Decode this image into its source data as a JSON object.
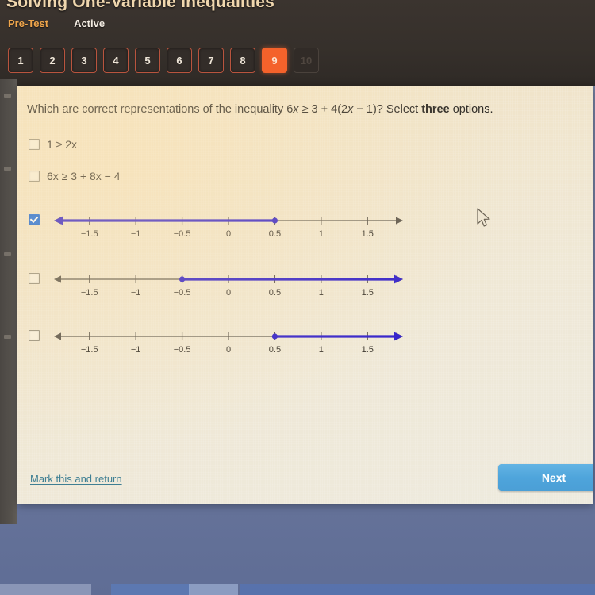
{
  "header": {
    "course_title": "Solving One-Variable Inequalities",
    "tabs": [
      {
        "label": "Pre-Test",
        "state": "section"
      },
      {
        "label": "Active",
        "state": "status"
      }
    ],
    "question_numbers": [
      "1",
      "2",
      "3",
      "4",
      "5",
      "6",
      "7",
      "8",
      "9",
      "10"
    ],
    "current_question": "9",
    "accent_color": "#f4622b",
    "pretest_color": "#f0a64b"
  },
  "question": {
    "prefix": "Which are correct representations of the inequality 6",
    "var1": "x",
    "mid": " ≥ 3 + 4(2",
    "var2": "x",
    "suffix": " − 1)? Select ",
    "emphasis": "three",
    "tail": " options."
  },
  "options": [
    {
      "id": "opt-1",
      "type": "text",
      "checked": false,
      "label": "1 ≥ 2x"
    },
    {
      "id": "opt-2",
      "type": "text",
      "checked": false,
      "label": "6x ≥ 3 + 8x − 4"
    },
    {
      "id": "opt-3",
      "type": "numberline",
      "checked": true,
      "endpoint": 0.5,
      "endpoint_style": "closed-dot",
      "direction": "left",
      "left_arrow": true,
      "right_arrow": true
    },
    {
      "id": "opt-4",
      "type": "numberline",
      "checked": false,
      "endpoint": -0.5,
      "endpoint_style": "closed-dot",
      "direction": "right",
      "left_arrow": true,
      "right_arrow": true
    },
    {
      "id": "opt-5",
      "type": "numberline",
      "checked": false,
      "endpoint": 0.5,
      "endpoint_style": "closed-dot",
      "direction": "right",
      "left_arrow": true,
      "right_arrow": true
    }
  ],
  "number_line": {
    "ticks": [
      "−1.5",
      "−1",
      "−0.5",
      "0",
      "0.5",
      "1",
      "1.5"
    ],
    "tick_values": [
      -1.5,
      -1,
      -0.5,
      0,
      0.5,
      1,
      1.5
    ],
    "axis_min": -1.9,
    "axis_max": 1.9,
    "highlight_color": "#3322cc",
    "axis_color": "#5d574e"
  },
  "footer": {
    "mark_link": "Mark this and return",
    "next_label": "Next",
    "next_color": "#4ea4db",
    "link_color": "#3f7f93"
  }
}
